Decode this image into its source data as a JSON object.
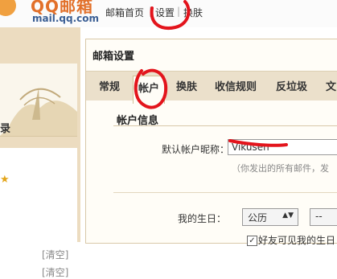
{
  "brand": {
    "logo_text": "QQ邮箱",
    "logo_domain": "mail.qq.com"
  },
  "topnav": {
    "items": [
      {
        "label": "邮箱首页"
      },
      {
        "label": "设置"
      },
      {
        "label": "换肤"
      }
    ],
    "separator": "|"
  },
  "sidebar": {
    "partial_label": "录",
    "clear_links": [
      "[清空]",
      "[清空]"
    ]
  },
  "settings": {
    "title": "邮箱设置",
    "tabs": [
      {
        "label": "常规"
      },
      {
        "label": "帐户",
        "active": true
      },
      {
        "label": "换肤"
      },
      {
        "label": "收信规则"
      },
      {
        "label": "反垃圾"
      },
      {
        "label": "文"
      }
    ],
    "account_section": {
      "heading": "帐户信息",
      "nickname_label": "默认帐户昵称：",
      "nickname_value": "Vikusen",
      "nickname_hint": "（你发出的所有邮件，发",
      "birthday_label": "我的生日：",
      "calendar_select": "公历",
      "second_select": "--",
      "friend_checkbox_label": "好友可见我的生日",
      "friend_checkbox_checked": true
    }
  },
  "colors": {
    "annotation": "#e3141c",
    "sidebar_bg": "#ecdcc0",
    "tabbar_bg": "#ebe0cb",
    "logo_orange": "#e2702a"
  }
}
